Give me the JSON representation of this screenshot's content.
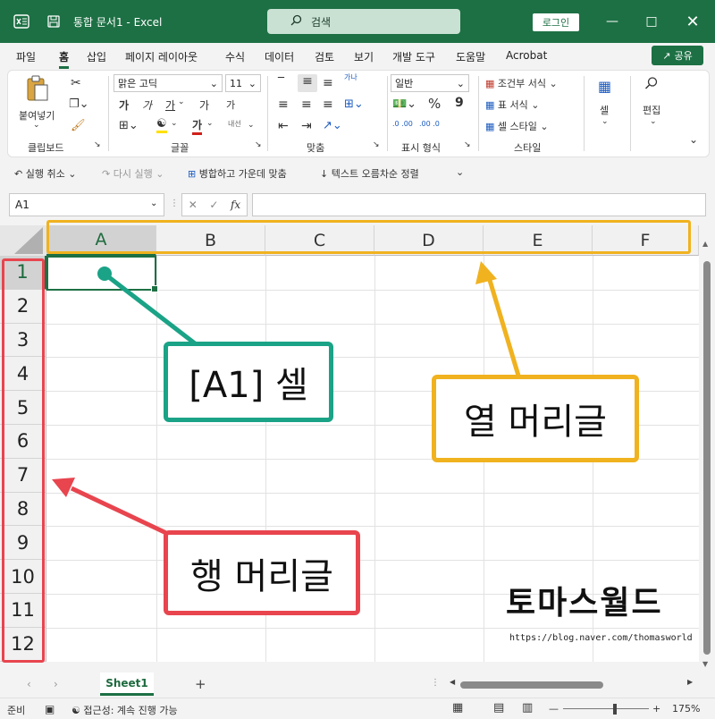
{
  "titlebar": {
    "doc_title": "통합 문서1  -  Excel",
    "search_label": "검색",
    "login_label": "로그인"
  },
  "menu": {
    "items": [
      "파일",
      "홈",
      "삽입",
      "페이지 레이아웃",
      "수식",
      "데이터",
      "검토",
      "보기",
      "개발 도구",
      "도움말",
      "Acrobat"
    ],
    "active": "홈",
    "share_label": "공유"
  },
  "ribbon": {
    "clipboard": {
      "label": "클립보드",
      "paste": "붙여넣기"
    },
    "font": {
      "label": "글꼴",
      "name": "맑은 고딕",
      "size": "11",
      "bold": "가",
      "italic": "가",
      "underline": "가",
      "grow": "가",
      "shrink": "가",
      "color": "가",
      "phonetic": "내선"
    },
    "alignment": {
      "label": "맞춤",
      "wrap": "가나"
    },
    "number": {
      "label": "표시 형식",
      "format": "일반",
      "percent": "%",
      "comma": "9",
      "inc": ".0 .00",
      "dec": ".00 .0"
    },
    "styles": {
      "label": "스타일",
      "conditional": "조건부 서식",
      "table": "표 서식",
      "cell_style": "셀 스타일"
    },
    "cells": {
      "label": "셀"
    },
    "editing": {
      "label": "편집"
    }
  },
  "qat": {
    "undo": "실행 취소",
    "redo": "다시 실행",
    "merge": "병합하고 가운데 맞춤",
    "sort": "텍스트 오름차순 정렬"
  },
  "formula_bar": {
    "name_box": "A1",
    "fx": "fx",
    "formula": ""
  },
  "grid": {
    "columns": [
      "A",
      "B",
      "C",
      "D",
      "E",
      "F"
    ],
    "rows": [
      "1",
      "2",
      "3",
      "4",
      "5",
      "6",
      "7",
      "8",
      "9",
      "10",
      "11",
      "12"
    ],
    "selected_col": "A",
    "selected_row": "1"
  },
  "sheets": {
    "tabs": [
      "Sheet1"
    ],
    "add": "+"
  },
  "status": {
    "ready": "준비",
    "accessibility": "접근성: 계속 진행 가능",
    "zoom": "175%"
  },
  "annotations": {
    "cell": "[A1] 셀",
    "column_header": "열 머리글",
    "row_header": "행 머리글",
    "watermark": "토마스월드",
    "watermark_url": "https://blog.naver.com/thomasworld"
  },
  "colors": {
    "brand": "#1d7044",
    "cell_callout": "#1aa386",
    "column_callout": "#f0b21f",
    "row_callout": "#e8454f"
  }
}
